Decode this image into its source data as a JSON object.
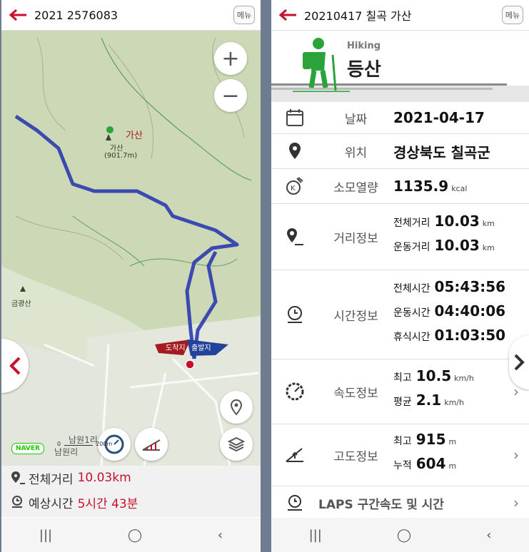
{
  "left": {
    "title": "2021 2576083",
    "menu_label": "메뉴",
    "map": {
      "peak_name": "가산",
      "peak_detail1": "가산",
      "peak_detail2": "(901.7m)",
      "mountain2": "금광산",
      "end_label": "도착지",
      "start_label": "출발지",
      "place1": "남원1리",
      "place2": "남원리",
      "scale_top": "0",
      "scale_val": "200m",
      "naver": "NAVER"
    },
    "total_distance_label": "전체거리",
    "total_distance_value": "10.03km",
    "expected_time_label": "예상시간",
    "expected_time_value": "5시간 43분"
  },
  "right": {
    "title": "20210417 칠곡 가산",
    "menu_label": "메뉴",
    "activity_en": "Hiking",
    "activity_kr": "등산",
    "date_label": "날짜",
    "date_value": "2021-04-17",
    "location_label": "위치",
    "location_value": "경상북도 칠곡군",
    "calorie_label": "소모열량",
    "calorie_value": "1135.9",
    "calorie_unit": "kcal",
    "distance_label": "거리정보",
    "distance": [
      {
        "label": "전체거리",
        "value": "10.03",
        "unit": "km"
      },
      {
        "label": "운동거리",
        "value": "10.03",
        "unit": "km"
      }
    ],
    "time_label": "시간정보",
    "time": [
      {
        "label": "전체시간",
        "value": "05:43:56"
      },
      {
        "label": "운동시간",
        "value": "04:40:06"
      },
      {
        "label": "휴식시간",
        "value": "01:03:50"
      }
    ],
    "speed_label": "속도정보",
    "speed": [
      {
        "label": "최고",
        "value": "10.5",
        "unit": "km/h"
      },
      {
        "label": "평균",
        "value": "2.1",
        "unit": "km/h"
      }
    ],
    "altitude_label": "고도정보",
    "altitude": [
      {
        "label": "최고",
        "value": "915",
        "unit": "m"
      },
      {
        "label": "누적",
        "value": "604",
        "unit": "m"
      }
    ],
    "laps_label": "LAPS 구간속도 및 시간"
  },
  "colors": {
    "accent": "#c8102e",
    "route": "#2b3bb0",
    "green": "#2aa43a"
  }
}
